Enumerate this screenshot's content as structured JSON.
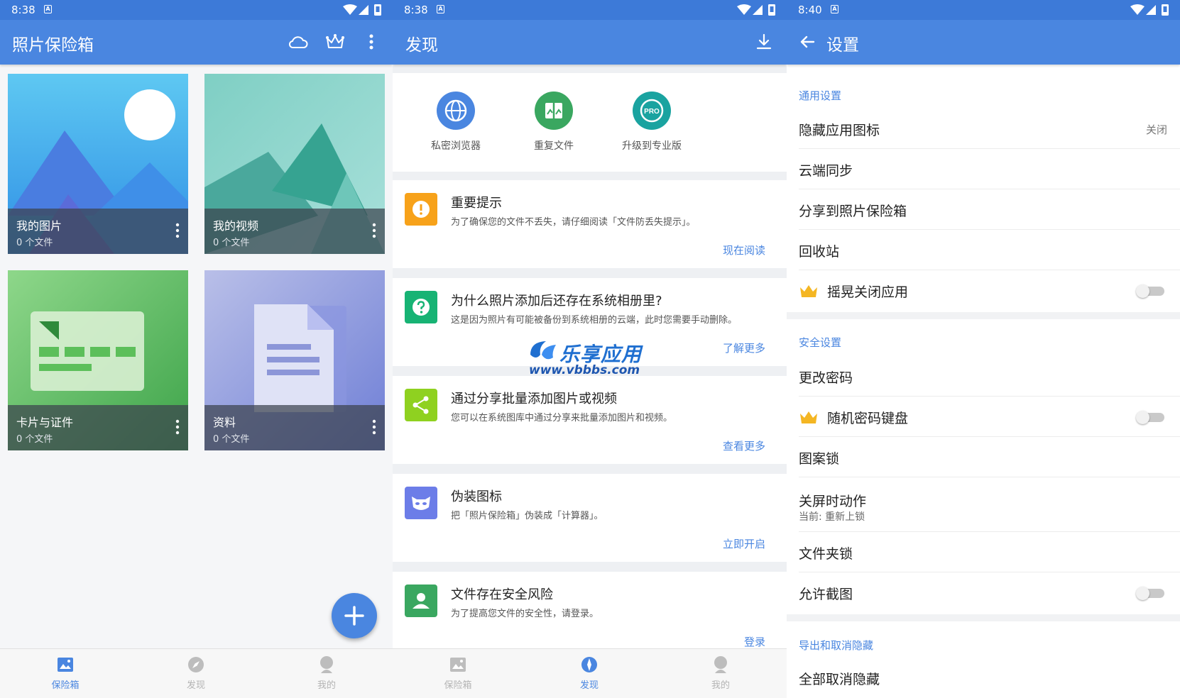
{
  "screens": [
    {
      "status": {
        "time": "8:38",
        "notif": "A"
      },
      "appbar": {
        "title": "照片保险箱",
        "icons": [
          "cloud-icon",
          "crown-icon",
          "more-vert-icon"
        ]
      },
      "tiles": [
        {
          "name": "我的图片",
          "count": "0 个文件"
        },
        {
          "name": "我的视频",
          "count": "0 个文件"
        },
        {
          "name": "卡片与证件",
          "count": "0 个文件"
        },
        {
          "name": "资料",
          "count": "0 个文件"
        }
      ],
      "nav": [
        {
          "label": "保险箱",
          "icon": "image-icon",
          "active": true
        },
        {
          "label": "发现",
          "icon": "compass-icon",
          "active": false
        },
        {
          "label": "我的",
          "icon": "person-icon",
          "active": false
        }
      ]
    },
    {
      "status": {
        "time": "8:38",
        "notif": "A"
      },
      "appbar": {
        "title": "发现",
        "icons": [
          "download-icon"
        ]
      },
      "quick": [
        {
          "label": "私密浏览器",
          "color": "#4a86e0",
          "icon": "globe-icon"
        },
        {
          "label": "重复文件",
          "color": "#3aa760",
          "icon": "duplicate-icon"
        },
        {
          "label": "升级到专业版",
          "color": "#1aa3a0",
          "icon": "pro-badge-icon",
          "badge": "PRO"
        }
      ],
      "tips": [
        {
          "title": "重要提示",
          "desc": "为了确保您的文件不丢失，请仔细阅读「文件防丢失提示」。",
          "action": "现在阅读",
          "color": "#f7a21a",
          "icon": "alert-icon"
        },
        {
          "title": "为什么照片添加后还存在系统相册里?",
          "desc": "这是因为照片有可能被备份到系统相册的云端，此时您需要手动删除。",
          "action": "了解更多",
          "color": "#17b374",
          "icon": "help-icon"
        },
        {
          "title": "通过分享批量添加图片或视频",
          "desc": "您可以在系统图库中通过分享来批量添加图片和视频。",
          "action": "查看更多",
          "color": "#8fd120",
          "icon": "share-icon"
        },
        {
          "title": "伪装图标",
          "desc": "把「照片保险箱」伪装成「计算器」。",
          "action": "立即开启",
          "color": "#6c7de8",
          "icon": "mask-icon"
        },
        {
          "title": "文件存在安全风险",
          "desc": "为了提高您文件的安全性，请登录。",
          "action": "登录",
          "color": "#3aa760",
          "icon": "account-icon"
        }
      ],
      "watermark": {
        "title": "乐享应用",
        "url": "www.vbbbs.com"
      },
      "nav": [
        {
          "label": "保险箱",
          "icon": "image-icon",
          "active": false
        },
        {
          "label": "发现",
          "icon": "compass-icon",
          "active": true
        },
        {
          "label": "我的",
          "icon": "person-icon",
          "active": false
        }
      ]
    },
    {
      "status": {
        "time": "8:40",
        "notif": "A"
      },
      "appbar": {
        "title": "设置",
        "icons": [
          "back-arrow-icon"
        ]
      },
      "sections": [
        {
          "title": "通用设置",
          "items": [
            {
              "label": "隐藏应用图标",
              "value": "关闭"
            },
            {
              "label": "云端同步"
            },
            {
              "label": "分享到照片保险箱"
            },
            {
              "label": "回收站"
            },
            {
              "label": "摇晃关闭应用",
              "premium": true,
              "toggle": false
            }
          ]
        },
        {
          "title": "安全设置",
          "items": [
            {
              "label": "更改密码"
            },
            {
              "label": "随机密码键盘",
              "premium": true,
              "toggle": false
            },
            {
              "label": "图案锁"
            },
            {
              "label": "关屏时动作",
              "sub": "当前: 重新上锁"
            },
            {
              "label": "文件夹锁"
            },
            {
              "label": "允许截图",
              "toggle": false
            }
          ]
        },
        {
          "title": "导出和取消隐藏",
          "items": [
            {
              "label": "全部取消隐藏"
            }
          ]
        }
      ]
    }
  ]
}
